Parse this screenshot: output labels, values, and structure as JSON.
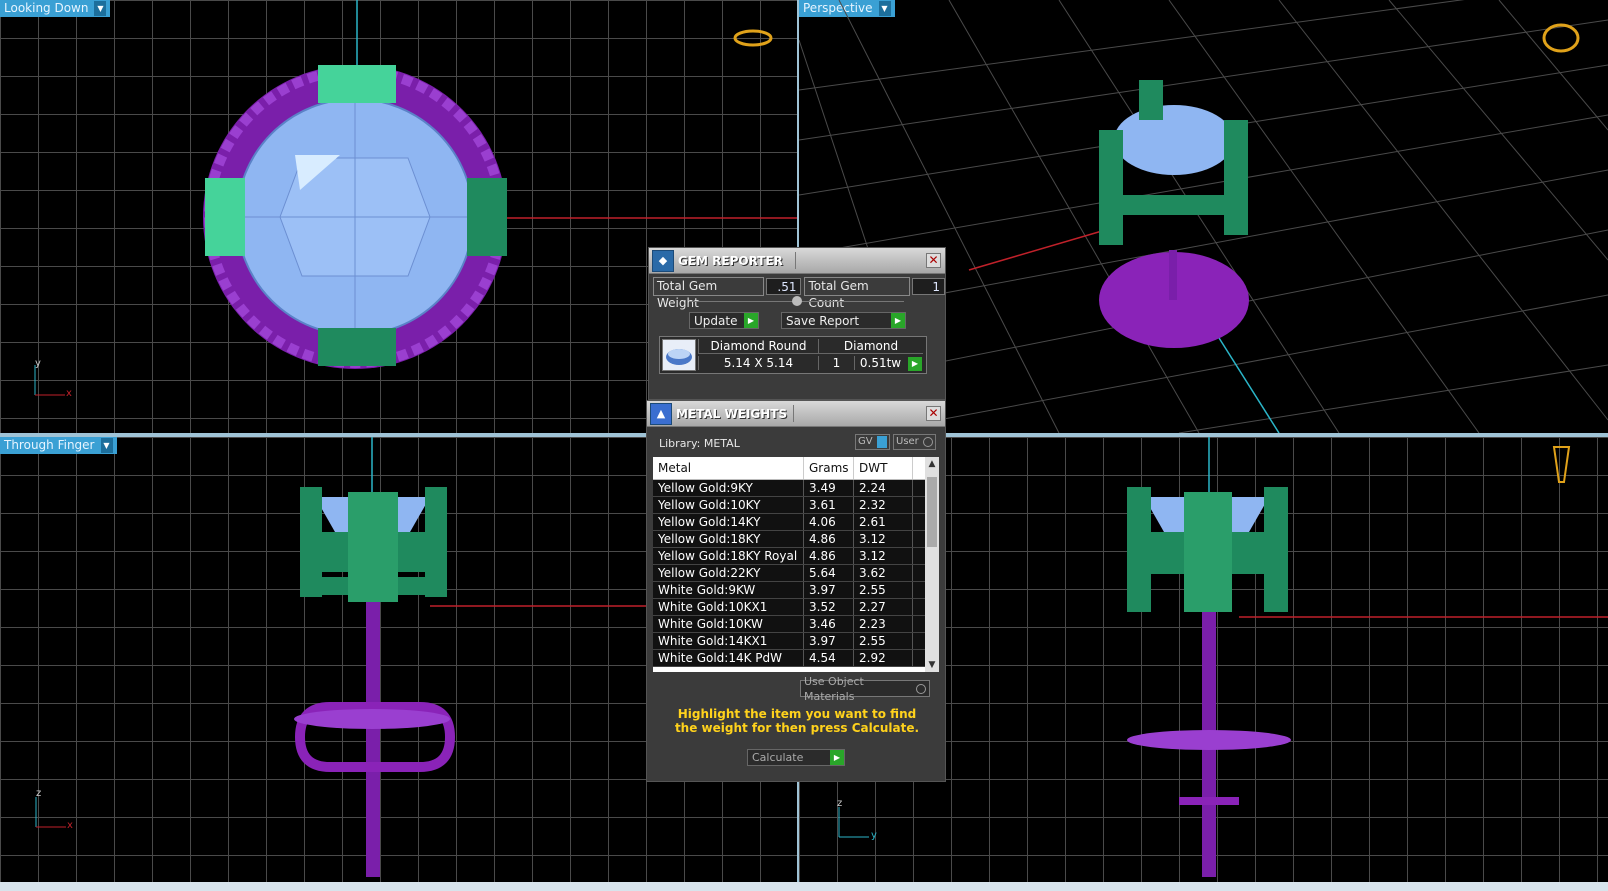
{
  "viewports": {
    "top_left": {
      "label": "Looking Down",
      "axes": [
        "y",
        "x"
      ]
    },
    "top_right": {
      "label": "Perspective"
    },
    "bottom_left": {
      "label": "Through Finger",
      "axes": [
        "z",
        "x"
      ]
    },
    "bottom_right": {
      "axes": [
        "z",
        "y"
      ]
    }
  },
  "gem_reporter": {
    "title": "GEM REPORTER",
    "total_weight_label": "Total Gem Weight",
    "total_weight_value": ".51",
    "total_count_label": "Total Gem Count",
    "total_count_value": "1",
    "update_label": "Update",
    "save_report_label": "Save Report",
    "gem": {
      "shape": "Diamond Round",
      "type": "Diamond",
      "size": "5.14 X 5.14",
      "count": "1",
      "weight": "0.51tw"
    }
  },
  "metal_weights": {
    "title": "METAL WEIGHTS",
    "library_label": "Library: METAL",
    "gv_label": "GV",
    "user_label": "User",
    "columns": [
      "Metal",
      "Grams",
      "DWT"
    ],
    "rows": [
      [
        "Yellow Gold:9KY",
        "3.49",
        "2.24"
      ],
      [
        "Yellow Gold:10KY",
        "3.61",
        "2.32"
      ],
      [
        "Yellow Gold:14KY",
        "4.06",
        "2.61"
      ],
      [
        "Yellow Gold:18KY",
        "4.86",
        "3.12"
      ],
      [
        "Yellow Gold:18KY Royal",
        "4.86",
        "3.12"
      ],
      [
        "Yellow Gold:22KY",
        "5.64",
        "3.62"
      ],
      [
        "White Gold:9KW",
        "3.97",
        "2.55"
      ],
      [
        "White Gold:10KX1",
        "3.52",
        "2.27"
      ],
      [
        "White Gold:10KW",
        "3.46",
        "2.23"
      ],
      [
        "White Gold:14KX1",
        "3.97",
        "2.55"
      ],
      [
        "White Gold:14K PdW",
        "4.54",
        "2.92"
      ]
    ],
    "use_object_materials_label": "Use Object Materials",
    "hint": "Highlight the item you want to find the weight for then press Calculate.",
    "calculate_label": "Calculate"
  },
  "colors": {
    "prong_green": "#1f8a5e",
    "prong_light": "#45d39a",
    "metal_purple": "#8a23b8",
    "gem_blue": "#8fb6f2",
    "axis_red": "#c0212a",
    "axis_cyan": "#2bb5c8",
    "hint_yellow": "#ffd21c"
  }
}
